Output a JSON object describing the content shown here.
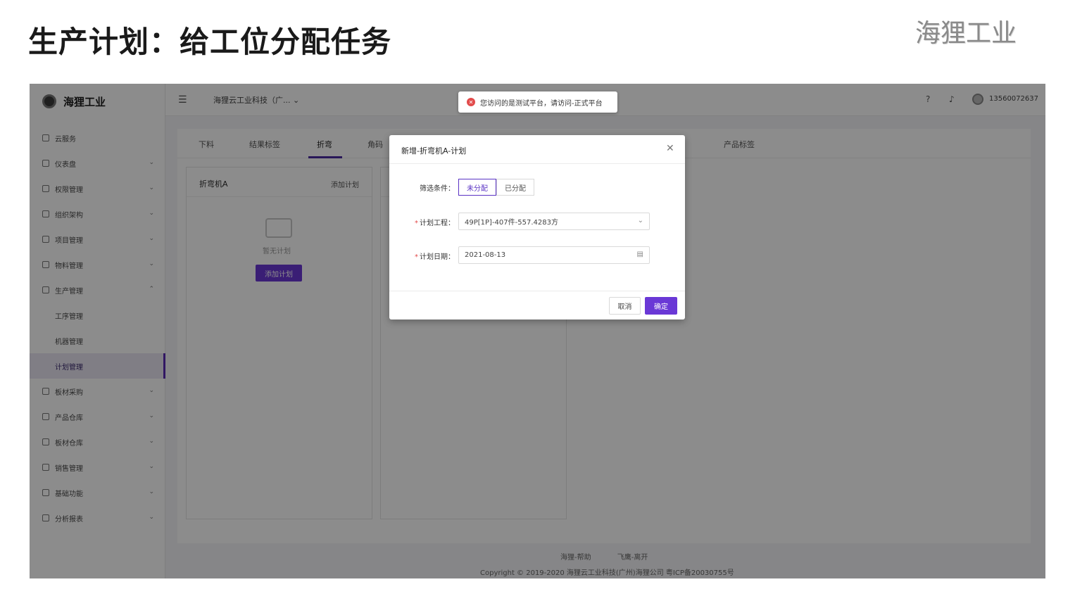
{
  "slide": {
    "title": "生产计划：给工位分配任务",
    "brand": "海狸工业"
  },
  "app": {
    "logo_text": "海狸工业",
    "company": "海狸云工业科技（广... ⌄",
    "user_phone": "13560072637",
    "sidebar": [
      {
        "label": "云服务",
        "icon": "cloud-icon",
        "caret": ""
      },
      {
        "label": "仪表盘",
        "icon": "dashboard-icon",
        "caret": "⌄"
      },
      {
        "label": "权限管理",
        "icon": "shield-icon",
        "caret": "⌄"
      },
      {
        "label": "组织架构",
        "icon": "org-icon",
        "caret": "⌄"
      },
      {
        "label": "项目管理",
        "icon": "project-icon",
        "caret": "⌄"
      },
      {
        "label": "物料管理",
        "icon": "material-icon",
        "caret": "⌄"
      },
      {
        "label": "生产管理",
        "icon": "production-icon",
        "caret": "⌃"
      },
      {
        "label": "工序管理",
        "sub": true
      },
      {
        "label": "机器管理",
        "sub": true
      },
      {
        "label": "计划管理",
        "sub": true,
        "active": true
      },
      {
        "label": "板材采购",
        "icon": "purchase-icon",
        "caret": "⌄"
      },
      {
        "label": "产品仓库",
        "icon": "warehouse-icon",
        "caret": "⌄"
      },
      {
        "label": "板材仓库",
        "icon": "box-icon",
        "caret": "⌄"
      },
      {
        "label": "销售管理",
        "icon": "sales-icon",
        "caret": "⌄"
      },
      {
        "label": "基础功能",
        "icon": "basic-icon",
        "caret": "⌄"
      },
      {
        "label": "分析报表",
        "icon": "report-icon",
        "caret": "⌄"
      }
    ],
    "tabs": [
      "下料",
      "结果标签",
      "折弯",
      "角码",
      "产品标签"
    ],
    "card": {
      "title": "折弯机A",
      "add_link": "添加计划",
      "empty_text": "暂无计划",
      "add_button": "添加计划"
    },
    "footer": {
      "links": [
        "海狸-帮助",
        "飞鹰-离开"
      ],
      "copyright": "Copyright © 2019-2020 海狸云工业科技(广州)海狸公司 粤ICP备20030755号"
    }
  },
  "notice": {
    "icon": "✕",
    "text": "您访问的是测试平台，请访问-正式平台"
  },
  "modal": {
    "title": "新增-折弯机A-计划",
    "close": "✕",
    "filter_label": "筛选条件：",
    "filter_options": [
      "未分配",
      "已分配"
    ],
    "project_label": "计划工程：",
    "project_value": "49P[1P]-407件-557.4283方",
    "date_label": "计划日期：",
    "date_value": "2021-08-13",
    "cancel": "取消",
    "confirm": "确定"
  }
}
